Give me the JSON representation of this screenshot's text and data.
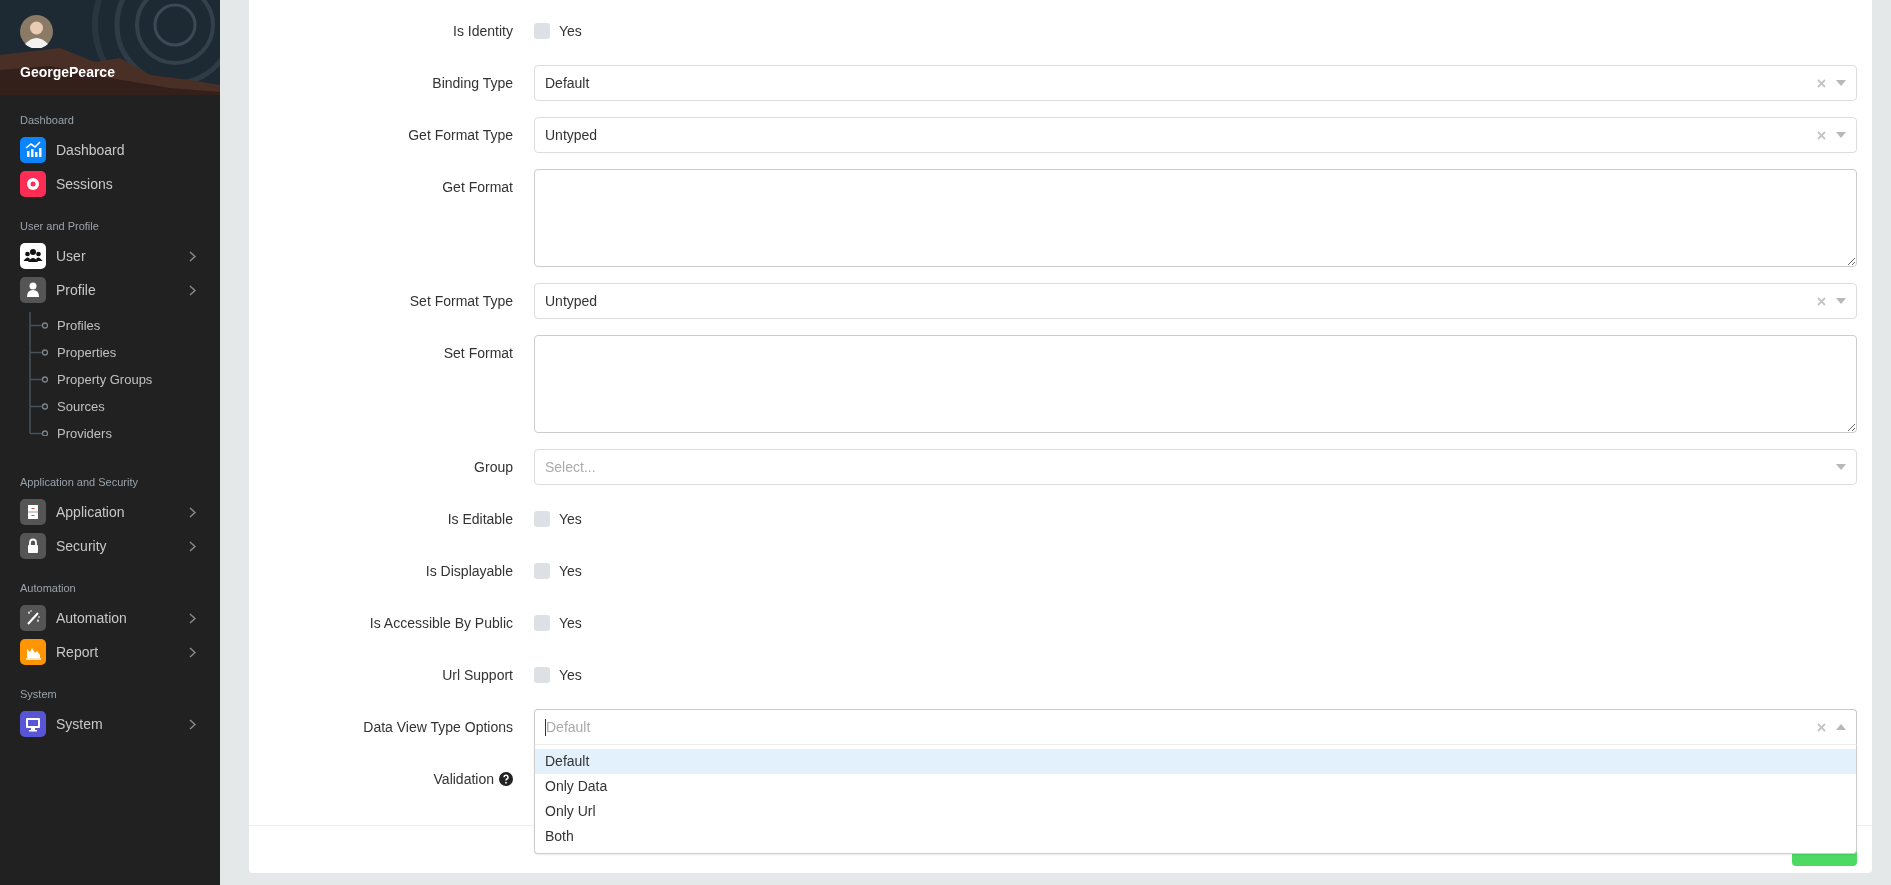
{
  "user": {
    "name": "GeorgePearce"
  },
  "sidebar": {
    "sections": [
      {
        "title": "Dashboard",
        "items": [
          {
            "label": "Dashboard",
            "color": "#0a84ff",
            "expandable": false
          },
          {
            "label": "Sessions",
            "color": "#ff2d55",
            "expandable": false
          }
        ]
      },
      {
        "title": "User and Profile",
        "items": [
          {
            "label": "User",
            "color": "#ffffff",
            "expandable": true
          },
          {
            "label": "Profile",
            "color": "#555555",
            "expandable": true,
            "children": [
              {
                "label": "Profiles"
              },
              {
                "label": "Properties"
              },
              {
                "label": "Property Groups"
              },
              {
                "label": "Sources"
              },
              {
                "label": "Providers"
              }
            ]
          }
        ]
      },
      {
        "title": "Application and Security",
        "items": [
          {
            "label": "Application",
            "color": "#555555",
            "expandable": true
          },
          {
            "label": "Security",
            "color": "#555555",
            "expandable": true
          }
        ]
      },
      {
        "title": "Automation",
        "items": [
          {
            "label": "Automation",
            "color": "#555555",
            "expandable": true
          },
          {
            "label": "Report",
            "color": "#ff9500",
            "expandable": true
          }
        ]
      },
      {
        "title": "System",
        "items": [
          {
            "label": "System",
            "color": "#5856d6",
            "expandable": true
          }
        ]
      }
    ]
  },
  "form": {
    "rows": [
      {
        "label": "Is Identity",
        "kind": "checkbox",
        "option": "Yes",
        "checked": false
      },
      {
        "label": "Binding Type",
        "kind": "select",
        "value": "Default",
        "clearable": true
      },
      {
        "label": "Get Format Type",
        "kind": "select",
        "value": "Untyped",
        "clearable": true
      },
      {
        "label": "Get Format",
        "kind": "textarea"
      },
      {
        "label": "Set Format Type",
        "kind": "select",
        "value": "Untyped",
        "clearable": true
      },
      {
        "label": "Set Format",
        "kind": "textarea"
      },
      {
        "label": "Group",
        "kind": "select",
        "placeholder": "Select...",
        "clearable": false
      },
      {
        "label": "Is Editable",
        "kind": "checkbox",
        "option": "Yes",
        "checked": false
      },
      {
        "label": "Is Displayable",
        "kind": "checkbox",
        "option": "Yes",
        "checked": false
      },
      {
        "label": "Is Accessible By Public",
        "kind": "checkbox",
        "option": "Yes",
        "checked": false
      },
      {
        "label": "Url Support",
        "kind": "checkbox",
        "option": "Yes",
        "checked": false
      },
      {
        "label": "Data View Type Options",
        "kind": "select",
        "placeholder": "Default",
        "clearable": true,
        "open": true,
        "options": [
          {
            "label": "Default",
            "selected": true
          },
          {
            "label": "Only Data",
            "selected": false
          },
          {
            "label": "Only Url",
            "selected": false
          },
          {
            "label": "Both",
            "selected": false
          }
        ]
      },
      {
        "label": "Validation",
        "kind": "covered",
        "help": true
      }
    ]
  }
}
